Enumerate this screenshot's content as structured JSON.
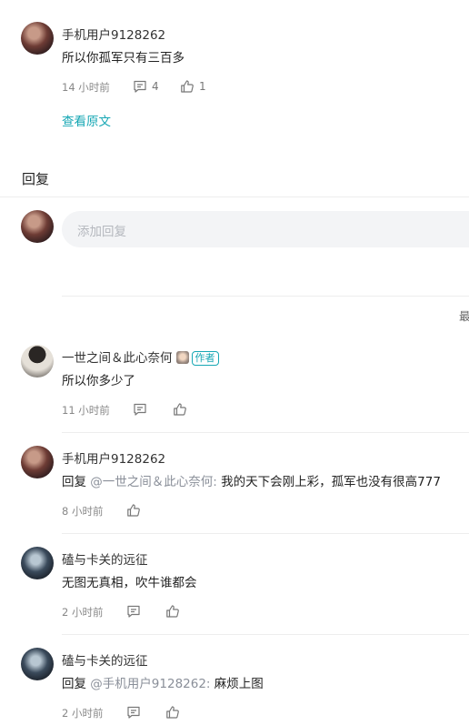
{
  "top_comment": {
    "author": "手机用户9128262",
    "content": "所以你孤军只有三百多",
    "time": "14 小时前",
    "comment_count": "4",
    "like_count": "1",
    "view_original": "查看原文"
  },
  "reply_section": {
    "title": "回复",
    "input_placeholder": "添加回复",
    "sort_label_partial": "最"
  },
  "replies": [
    {
      "author": "一世之间＆此心奈何",
      "badge": "作者",
      "content": "所以你多少了",
      "time": "11 小时前"
    },
    {
      "author": "手机用户9128262",
      "reply_prefix": "回复",
      "mention": "@一世之间＆此心奈何:",
      "content": "我的天下会刚上彩，孤军也没有很高777",
      "time": "8 小时前"
    },
    {
      "author": "磕与卡关的远征",
      "content": "无图无真相，吹牛谁都会",
      "time": "2 小时前"
    },
    {
      "author": "磕与卡关的远征",
      "reply_prefix": "回复",
      "mention": "@手机用户9128262:",
      "content": "麻烦上图",
      "time": "2 小时前"
    }
  ],
  "colors": {
    "accent": "#16a7b4",
    "meta_text": "#888888",
    "input_bg": "#f3f4f6"
  }
}
